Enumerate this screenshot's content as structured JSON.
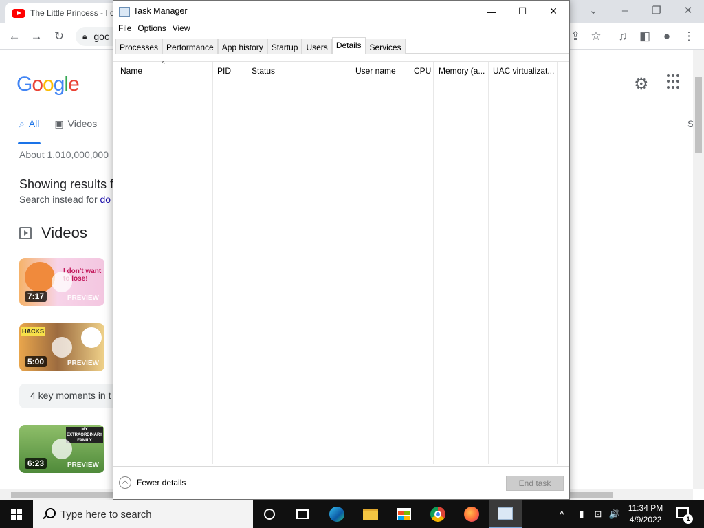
{
  "chrome": {
    "tab_title": "The Little Princess - I d",
    "omnibox_text": "goc",
    "minimize": "–",
    "maximize": "❐",
    "close": "✕",
    "tab_dropdown": "⌄"
  },
  "google": {
    "logo_letters": [
      "G",
      "o",
      "o",
      "g",
      "l",
      "e"
    ],
    "logo_colors": [
      "#4285f4",
      "#ea4335",
      "#fbbc05",
      "#4285f4",
      "#34a853",
      "#ea4335"
    ],
    "tab_all": "All",
    "tab_videos": "Videos",
    "right_tab_partial": "S",
    "result_count": "About 1,010,000,000",
    "showing_results": "Showing results f",
    "search_instead_prefix": "Search instead for ",
    "search_instead_link": "do",
    "videos_heading": "Videos",
    "key_moments": "4 key moments in t",
    "videos": [
      {
        "duration": "7:17",
        "preview": "PREVIEW",
        "thumb_text": "I don't want to lose!"
      },
      {
        "duration": "5:00",
        "preview": "PREVIEW",
        "thumb_text": "HACKS"
      },
      {
        "duration": "6:23",
        "preview": "PREVIEW",
        "thumb_text": "MY EXTRAORDINARY FAMILY"
      }
    ]
  },
  "task_manager": {
    "title": "Task Manager",
    "minimize": "—",
    "maximize": "☐",
    "close": "✕",
    "menu": [
      "File",
      "Options",
      "View"
    ],
    "tabs": [
      "Processes",
      "Performance",
      "App history",
      "Startup",
      "Users",
      "Details",
      "Services"
    ],
    "active_tab": "Details",
    "columns": [
      "Name",
      "PID",
      "Status",
      "User name",
      "CPU",
      "Memory (a...",
      "UAC virtualizat..."
    ],
    "sort_indicator": "^",
    "fewer_details": "Fewer details",
    "end_task": "End task"
  },
  "taskbar": {
    "search_placeholder": "Type here to search",
    "tray_chevron": "^",
    "time": "11:34 PM",
    "date": "4/9/2022",
    "notification_count": "1",
    "volume_glyph": "🔊"
  }
}
